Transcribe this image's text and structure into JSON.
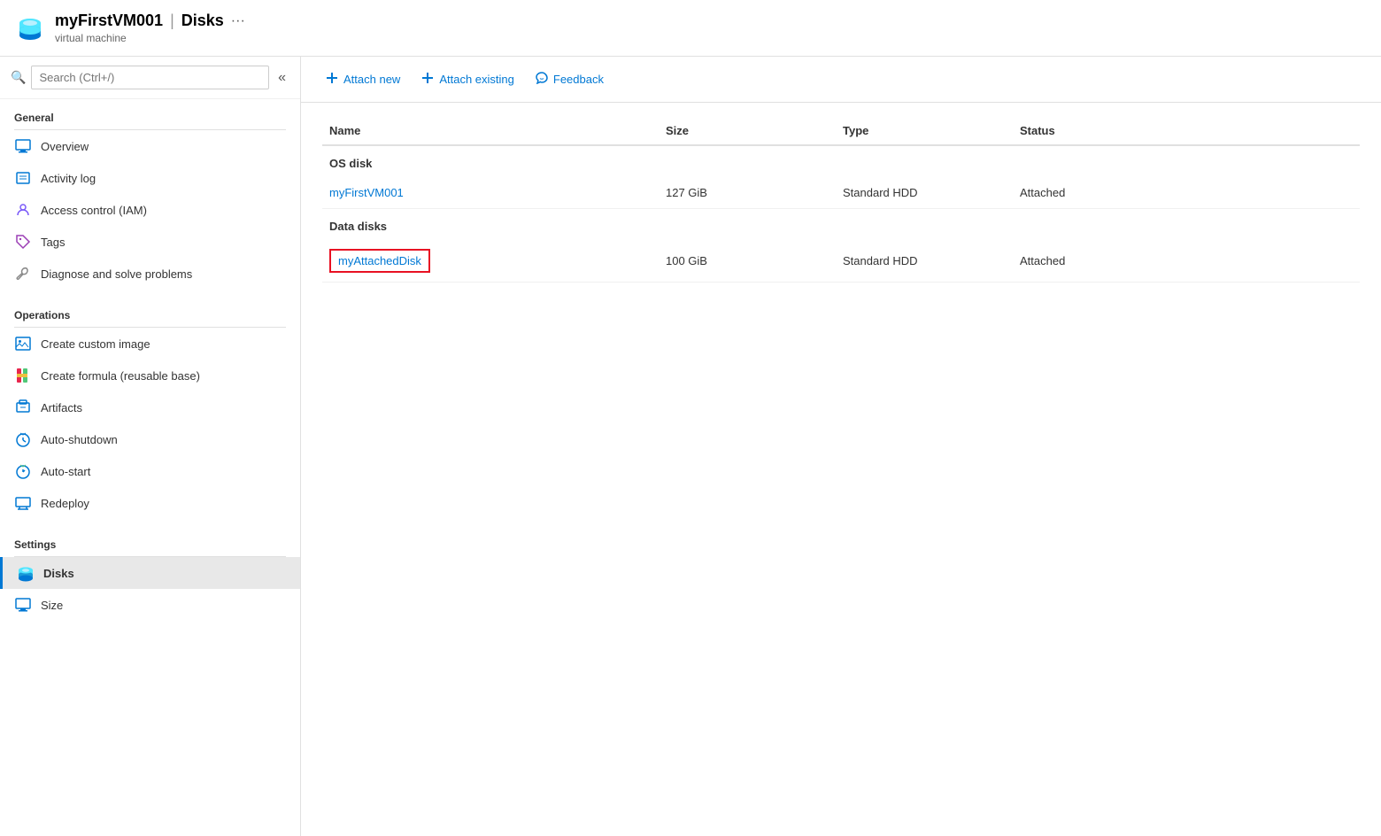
{
  "header": {
    "title": "myFirstVM001 | Disks",
    "title_name": "myFirstVM001",
    "title_section": "Disks",
    "subtitle": "virtual machine",
    "more_icon": "···"
  },
  "sidebar": {
    "search_placeholder": "Search (Ctrl+/)",
    "collapse_icon": "«",
    "sections": [
      {
        "label": "General",
        "items": [
          {
            "id": "overview",
            "label": "Overview",
            "icon": "monitor"
          },
          {
            "id": "activity-log",
            "label": "Activity log",
            "icon": "list"
          },
          {
            "id": "access-control",
            "label": "Access control (IAM)",
            "icon": "person"
          },
          {
            "id": "tags",
            "label": "Tags",
            "icon": "tag"
          },
          {
            "id": "diagnose",
            "label": "Diagnose and solve problems",
            "icon": "wrench"
          }
        ]
      },
      {
        "label": "Operations",
        "items": [
          {
            "id": "create-image",
            "label": "Create custom image",
            "icon": "image"
          },
          {
            "id": "create-formula",
            "label": "Create formula (reusable base)",
            "icon": "formula"
          },
          {
            "id": "artifacts",
            "label": "Artifacts",
            "icon": "artifact"
          },
          {
            "id": "auto-shutdown",
            "label": "Auto-shutdown",
            "icon": "clock"
          },
          {
            "id": "auto-start",
            "label": "Auto-start",
            "icon": "clock2"
          },
          {
            "id": "redeploy",
            "label": "Redeploy",
            "icon": "redeploy"
          }
        ]
      },
      {
        "label": "Settings",
        "items": [
          {
            "id": "disks",
            "label": "Disks",
            "icon": "disk",
            "active": true
          },
          {
            "id": "size",
            "label": "Size",
            "icon": "monitor2"
          }
        ]
      }
    ]
  },
  "toolbar": {
    "attach_new_label": "Attach new",
    "attach_existing_label": "Attach existing",
    "feedback_label": "Feedback"
  },
  "table": {
    "columns": [
      "Name",
      "Size",
      "Type",
      "Status"
    ],
    "os_disk_section": "OS disk",
    "data_disks_section": "Data disks",
    "os_disks": [
      {
        "name": "myFirstVM001",
        "size": "127 GiB",
        "type": "Standard HDD",
        "status": "Attached"
      }
    ],
    "data_disks": [
      {
        "name": "myAttachedDisk",
        "size": "100 GiB",
        "type": "Standard HDD",
        "status": "Attached",
        "highlighted": true
      }
    ]
  }
}
